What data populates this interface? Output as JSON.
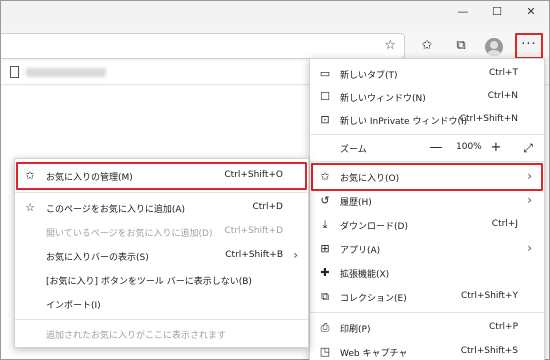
{
  "window": {
    "minimize_glyph": "—",
    "maximize_glyph": "☐",
    "close_glyph": "✕"
  },
  "toolbar": {
    "more_label": "···",
    "address_star_glyph": "☆",
    "favorites_glyph": "✩",
    "collections_glyph": "⧉"
  },
  "menu": {
    "items": [
      {
        "icon": "new-tab-icon",
        "glyph": "▭",
        "label": "新しいタブ(T)",
        "shortcut": "Ctrl+T"
      },
      {
        "icon": "new-window-icon",
        "glyph": "☐",
        "label": "新しいウィンドウ(N)",
        "shortcut": "Ctrl+N"
      },
      {
        "icon": "inprivate-icon",
        "glyph": "⊡",
        "label": "新しい InPrivate ウィンドウ(I)",
        "shortcut": "Ctrl+Shift+N"
      }
    ],
    "zoom": {
      "label": "ズーム",
      "minus": "—",
      "value": "100%",
      "plus": "+",
      "fullscreen": "⤢"
    },
    "items2": [
      {
        "icon": "favorites-icon",
        "glyph": "✩",
        "label": "お気に入り(O)",
        "shortcut": "",
        "chevron": "›"
      },
      {
        "icon": "history-icon",
        "glyph": "↺",
        "label": "履歴(H)",
        "shortcut": "",
        "chevron": "›"
      },
      {
        "icon": "download-icon",
        "glyph": "⤓",
        "label": "ダウンロード(D)",
        "shortcut": "Ctrl+J"
      },
      {
        "icon": "apps-icon",
        "glyph": "⊞",
        "label": "アプリ(A)",
        "shortcut": "",
        "chevron": "›"
      },
      {
        "icon": "extensions-icon",
        "glyph": "✚",
        "label": "拡張機能(X)",
        "shortcut": ""
      },
      {
        "icon": "collections-icon",
        "glyph": "⧉",
        "label": "コレクション(E)",
        "shortcut": "Ctrl+Shift+Y"
      },
      {
        "icon": "print-icon",
        "glyph": "⎙",
        "label": "印刷(P)",
        "shortcut": "Ctrl+P"
      },
      {
        "icon": "web-capture-icon",
        "glyph": "◳",
        "label": "Web キャプチャ",
        "shortcut": "Ctrl+Shift+S"
      }
    ]
  },
  "submenu": {
    "items": [
      {
        "icon": "manage-favorites-icon",
        "glyph": "✩",
        "label": "お気に入りの管理(M)",
        "shortcut": "Ctrl+Shift+O",
        "disabled": false
      },
      {
        "icon": "add-favorite-icon",
        "glyph": "☆",
        "label": "このページをお気に入りに追加(A)",
        "shortcut": "Ctrl+D",
        "disabled": false
      },
      {
        "icon": "",
        "glyph": "",
        "label": "開いているページをお気に入りに追加(D)",
        "shortcut": "Ctrl+Shift+D",
        "disabled": true
      },
      {
        "icon": "",
        "glyph": "",
        "label": "お気に入りバーの表示(S)",
        "shortcut": "Ctrl+Shift+B",
        "chevron": "›",
        "disabled": false
      },
      {
        "icon": "",
        "glyph": "",
        "label": "[お気に入り] ボタンをツール バーに表示しない(B)",
        "shortcut": "",
        "disabled": false
      },
      {
        "icon": "",
        "glyph": "",
        "label": "インポート(I)",
        "shortcut": "",
        "disabled": false
      },
      {
        "icon": "",
        "glyph": "",
        "label": "追加されたお気に入りがここに表示されます",
        "shortcut": "",
        "disabled": true
      }
    ]
  },
  "colors": {
    "highlight": "#e0242a"
  }
}
